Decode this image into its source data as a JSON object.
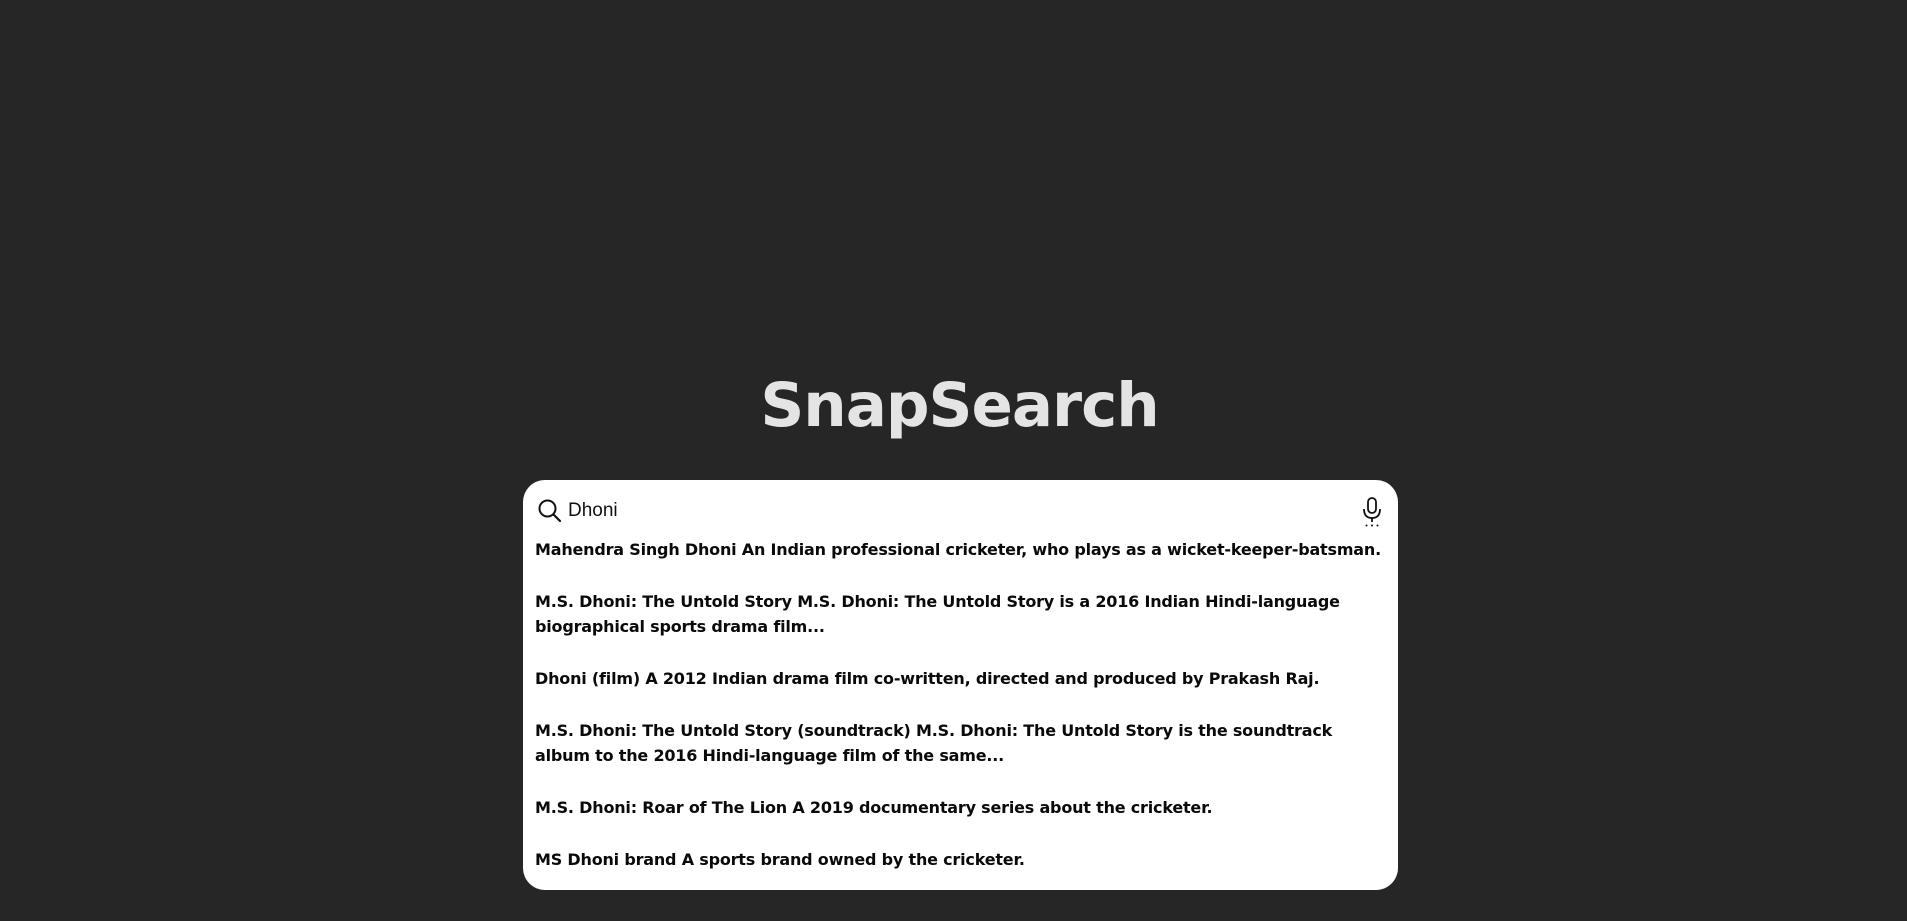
{
  "app": {
    "title": "SnapSearch"
  },
  "search": {
    "value": "Dhoni",
    "placeholder": ""
  },
  "icons": {
    "search": "search-icon",
    "mic": "microphone-icon"
  },
  "colors": {
    "background": "#262626",
    "title": "#e4e4e4",
    "card": "#ffffff",
    "text": "#0a0a0a"
  },
  "suggestions": [
    {
      "title": "Mahendra Singh Dhoni",
      "description": "An Indian professional cricketer, who plays as a wicket-keeper-batsman."
    },
    {
      "title": "M.S. Dhoni: The Untold Story",
      "description": "M.S. Dhoni: The Untold Story is a 2016 Indian Hindi-language biographical sports drama film..."
    },
    {
      "title": "Dhoni (film)",
      "description": "A 2012 Indian drama film co-written, directed and produced by Prakash Raj."
    },
    {
      "title": "M.S. Dhoni: The Untold Story (soundtrack)",
      "description": "M.S. Dhoni: The Untold Story is the soundtrack album to the 2016 Hindi-language film of the same..."
    },
    {
      "title": "M.S. Dhoni: Roar of The Lion",
      "description": "A 2019 documentary series about the cricketer."
    },
    {
      "title": "MS Dhoni brand",
      "description": "A sports brand owned by the cricketer."
    }
  ]
}
